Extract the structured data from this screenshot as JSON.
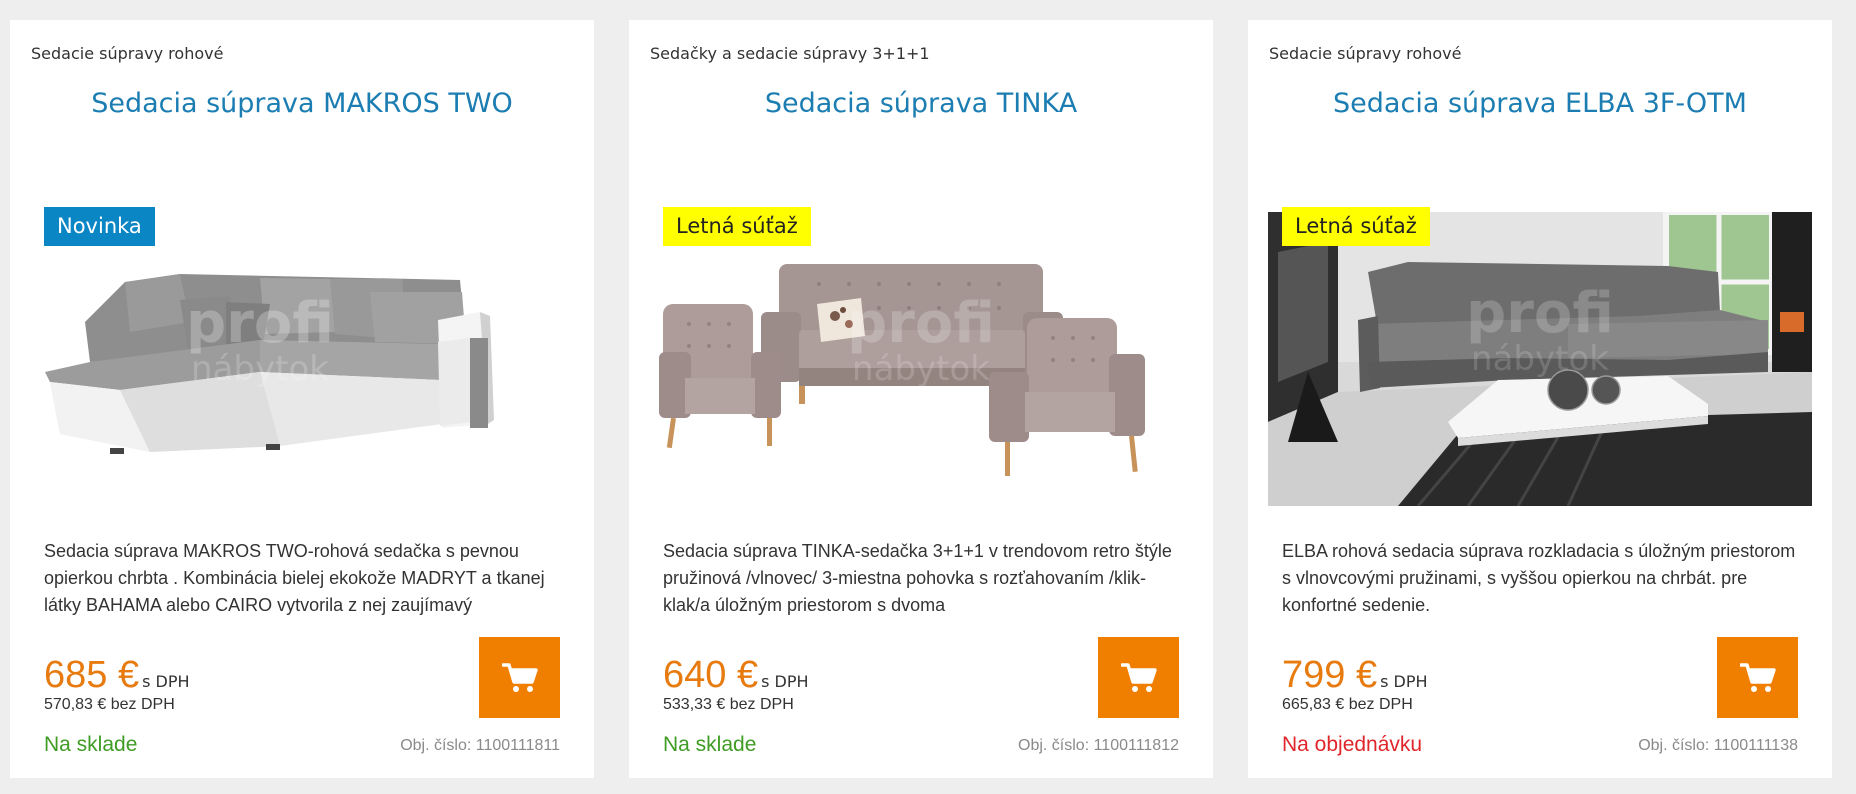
{
  "colors": {
    "page_bg": "#eeeeee",
    "title": "#1b7db1",
    "price": "#e77b10",
    "cart_button": "#f07f00",
    "badge_new": "#0a86c5",
    "badge_summer": "#ffff00",
    "in_stock": "#3f9c24",
    "on_order": "#e0262a"
  },
  "products": [
    {
      "category": "Sedacie súpravy rohové",
      "title": "Sedacia súprava MAKROS TWO",
      "badge": "Novinka",
      "badge_style": "blue",
      "image": "corner-sofa-grey-white",
      "description": "Sedacia súprava MAKROS TWO-rohová sedačka s pevnou opierkou chrbta . Kombinácia bielej ekokože MADRYT a tkanej látky BAHAMA alebo CAIRO vytvorila z nej zaujímavý",
      "price": "685 €",
      "price_vat_label": "s DPH",
      "price_net": "570,83 € bez DPH",
      "stock": "Na sklade",
      "stock_state": "in",
      "object_number": "Obj. číslo: 1100111811"
    },
    {
      "category": "Sedačky a sedacie súpravy 3+1+1",
      "title": "Sedacia súprava TINKA",
      "badge": "Letná súťaž",
      "badge_style": "yellow",
      "image": "sofa-set-3-1-1-taupe",
      "description": "Sedacia súprava TINKA-sedačka 3+1+1 v trendovom retro štýle pružinová /vlnovec/ 3-miestna pohovka s rozťahovaním /klik-klak/a úložným priestorom s dvoma",
      "price": "640 €",
      "price_vat_label": "s DPH",
      "price_net": "533,33 € bez DPH",
      "stock": "Na sklade",
      "stock_state": "in",
      "object_number": "Obj. číslo: 1100111812"
    },
    {
      "category": "Sedacie súpravy rohové",
      "title": "Sedacia súprava ELBA 3F-OTM",
      "badge": "Letná súťaž",
      "badge_style": "yellow",
      "image": "corner-sofa-grey-room",
      "description": "ELBA rohová sedacia súprava rozkladacia s úložným priestorom s vlnovcovými pružinami, s vyššou opierkou na chrbát. pre konfortné sedenie.",
      "price": "799 €",
      "price_vat_label": "s DPH",
      "price_net": "665,83 € bez DPH",
      "stock": "Na objednávku",
      "stock_state": "order",
      "object_number": "Obj. číslo: 1100111138"
    }
  ],
  "cart_icon": "shopping-cart-icon"
}
